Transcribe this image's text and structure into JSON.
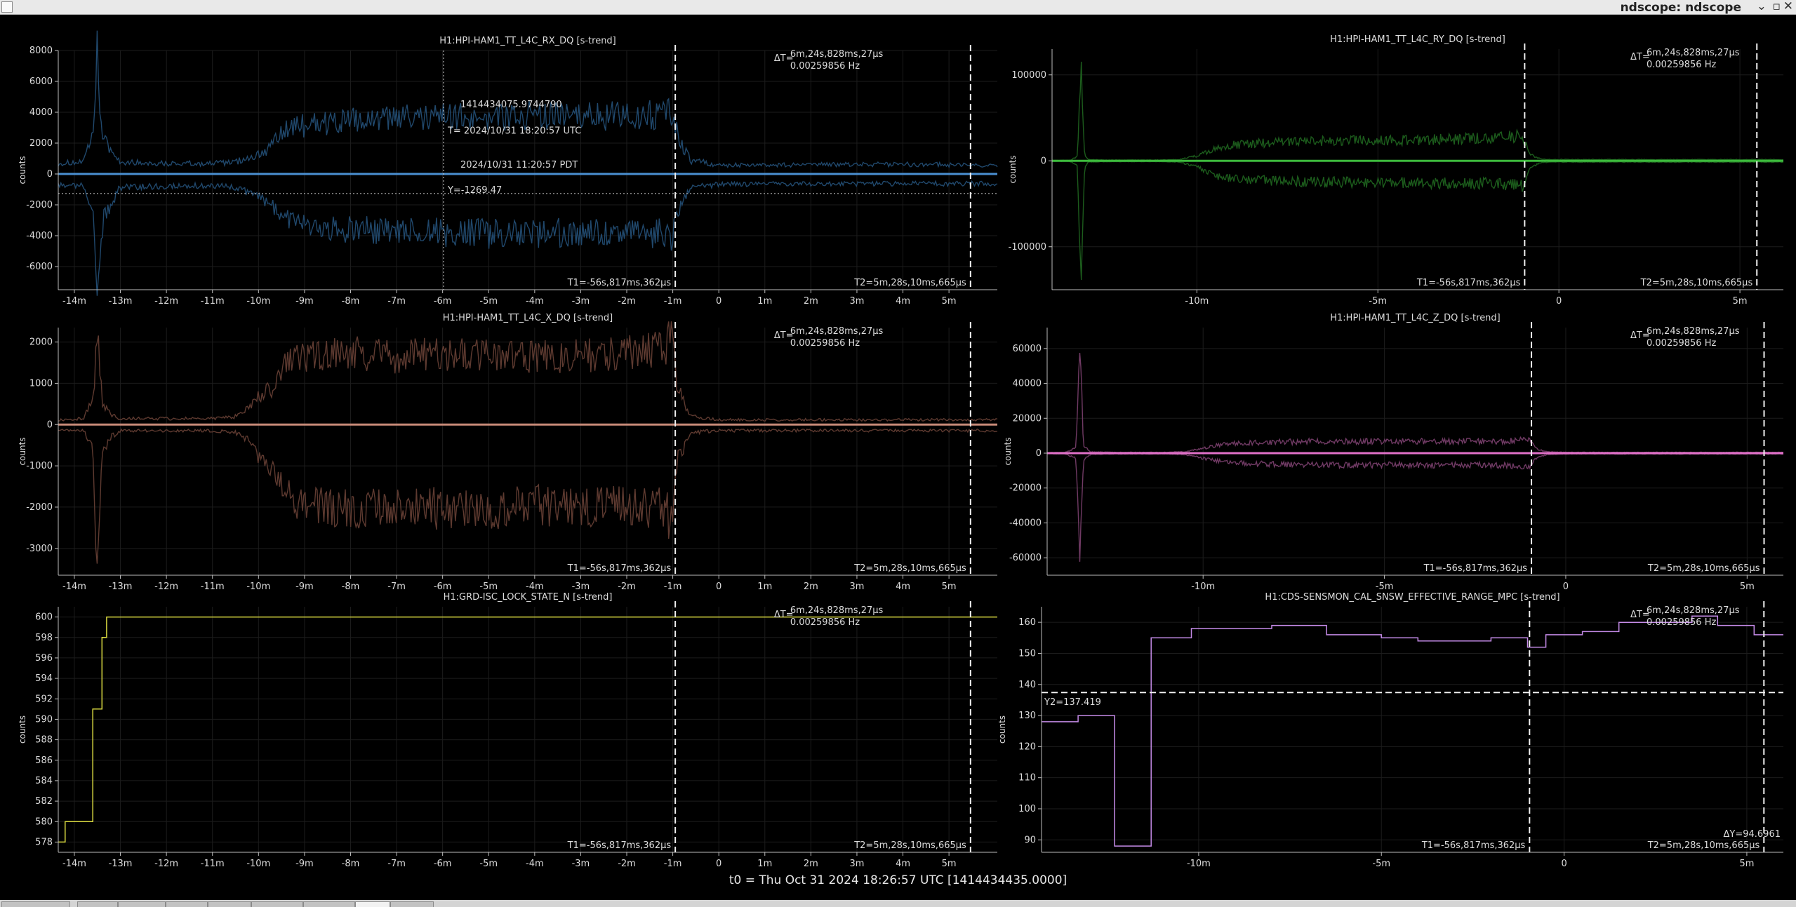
{
  "window": {
    "title": "ndscope: ndscope",
    "buttons": [
      "⌄",
      "▫",
      "✕"
    ]
  },
  "status": {
    "t0": "t0 = Thu Oct 31 2024 18:26:57 UTC [1414434435.0000]"
  },
  "chart_data": [
    {
      "type": "line",
      "title": "H1:HPI-HAM1_TT_L4C_RX_DQ [s-trend]",
      "ylabel": "counts",
      "xlabel": "",
      "color": "#4a8fd1",
      "band_color": "#20486c",
      "xlim": [
        -14.35,
        6.05
      ],
      "ylim": [
        -7500,
        8000
      ],
      "x_ticks": [
        -14,
        -13,
        -12,
        -11,
        -10,
        -9,
        -8,
        -7,
        -6,
        -5,
        -4,
        -3,
        -2,
        -1,
        0,
        1,
        2,
        3,
        4,
        5
      ],
      "x_tick_labels": [
        "-14m",
        "-13m",
        "-12m",
        "-11m",
        "-10m",
        "-9m",
        "-8m",
        "-7m",
        "-6m",
        "-5m",
        "-4m",
        "-3m",
        "-2m",
        "-1m",
        "0",
        "1m",
        "2m",
        "3m",
        "4m",
        "5m"
      ],
      "y_ticks": [
        -6000,
        -4000,
        -2000,
        0,
        2000,
        4000,
        6000,
        8000
      ],
      "y_tick_labels": [
        "-6000",
        "-4000",
        "-2000",
        "0",
        "2000",
        "4000",
        "6000",
        "8000"
      ],
      "envelope": {
        "x": [
          -14.35,
          -13.8,
          -13.6,
          -13.5,
          -13.4,
          -13.2,
          -13.0,
          -12.0,
          -11.0,
          -10.5,
          -10.3,
          -10.0,
          -9.7,
          -9.5,
          -9.3,
          -9.0,
          -8.0,
          -7.0,
          -6.0,
          -5.0,
          -4.0,
          -3.0,
          -2.0,
          -1.2,
          -1.0,
          -0.9,
          -0.6,
          0,
          1,
          2,
          3,
          4,
          5,
          6.05
        ],
        "upper": [
          700,
          800,
          2500,
          8000,
          2500,
          1500,
          800,
          700,
          700,
          800,
          1000,
          1300,
          1900,
          2600,
          3100,
          3300,
          3500,
          3700,
          3800,
          3900,
          3900,
          3800,
          3900,
          4000,
          4300,
          2500,
          900,
          600,
          600,
          600,
          650,
          650,
          600,
          550
        ],
        "lower": [
          -700,
          -800,
          -2500,
          -7500,
          -3500,
          -2000,
          -900,
          -800,
          -800,
          -900,
          -1100,
          -1500,
          -2100,
          -2700,
          -3200,
          -3500,
          -3700,
          -3800,
          -3900,
          -4000,
          -4000,
          -3900,
          -3900,
          -4000,
          -4200,
          -2500,
          -900,
          -700,
          -650,
          -650,
          -650,
          -650,
          -650,
          -650
        ]
      },
      "mean_y": 0,
      "cursor": {
        "x": -5.98,
        "y": -1269.47,
        "gps": "1414434075.9744790",
        "utc": "T= 2024/10/31 18:20:57 UTC",
        "local": "2024/10/31 11:20:57 PDT",
        "y_label": "Y=-1269.47"
      },
      "t1": -0.946,
      "t2": 5.468,
      "t1_label": "T1=-56s,817ms,362μs",
      "t2_label": "T2=5m,28s,10ms,665μs",
      "delta_label": "ΔT=",
      "delta_t": "6m,24s,828ms,27μs",
      "delta_hz": "0.00259856 Hz"
    },
    {
      "type": "line",
      "title": "H1:HPI-HAM1_TT_L4C_RY_DQ [s-trend]",
      "ylabel": "counts",
      "xlabel": "",
      "color": "#3dba3d",
      "band_color": "#1c5c1c",
      "xlim": [
        -14.0,
        6.2
      ],
      "ylim": [
        -150000,
        130000
      ],
      "x_ticks": [
        -10,
        -5,
        0,
        5
      ],
      "x_tick_labels": [
        "-10m",
        "-5m",
        "0",
        "5m"
      ],
      "y_ticks": [
        -100000,
        0,
        100000
      ],
      "y_tick_labels": [
        "-100000",
        "0",
        "100000"
      ],
      "envelope": {
        "x": [
          -14.0,
          -13.5,
          -13.3,
          -13.2,
          -13.1,
          -13.0,
          -12.5,
          -11.0,
          -10.5,
          -10.0,
          -9.5,
          -9.0,
          -8.0,
          -7.0,
          -6.0,
          -5.0,
          -4.0,
          -3.0,
          -2.0,
          -1.2,
          -1.0,
          -0.8,
          -0.5,
          0,
          2,
          4,
          6.2
        ],
        "upper": [
          600,
          800,
          5000,
          125000,
          8000,
          1500,
          1000,
          1000,
          1500,
          6000,
          14000,
          19000,
          22000,
          24000,
          24000,
          25000,
          25000,
          26000,
          27000,
          29000,
          30000,
          8000,
          2000,
          1500,
          1500,
          1500,
          1500
        ],
        "lower": [
          -600,
          -800,
          -5000,
          -135000,
          -8000,
          -1500,
          -1000,
          -1000,
          -1500,
          -7000,
          -18000,
          -21000,
          -24000,
          -25000,
          -26000,
          -26000,
          -26000,
          -27000,
          -27000,
          -29000,
          -30000,
          -8000,
          -2000,
          -1500,
          -1500,
          -1500,
          -1500
        ]
      },
      "mean_y": 0,
      "t1": -0.946,
      "t2": 5.468,
      "t1_label": "T1=-56s,817ms,362μs",
      "t2_label": "T2=5m,28s,10ms,665μs",
      "delta_label": "ΔT=",
      "delta_t": "6m,24s,828ms,27μs",
      "delta_hz": "0.00259856 Hz"
    },
    {
      "type": "line",
      "title": "H1:HPI-HAM1_TT_L4C_X_DQ [s-trend]",
      "ylabel": "counts",
      "xlabel": "",
      "color": "#c88a78",
      "band_color": "#5e3a30",
      "xlim": [
        -14.35,
        6.05
      ],
      "ylim": [
        -3650,
        2350
      ],
      "x_ticks": [
        -14,
        -13,
        -12,
        -11,
        -10,
        -9,
        -8,
        -7,
        -6,
        -5,
        -4,
        -3,
        -2,
        -1,
        0,
        1,
        2,
        3,
        4,
        5
      ],
      "x_tick_labels": [
        "-14m",
        "-13m",
        "-12m",
        "-11m",
        "-10m",
        "-9m",
        "-8m",
        "-7m",
        "-6m",
        "-5m",
        "-4m",
        "-3m",
        "-2m",
        "-1m",
        "0",
        "1m",
        "2m",
        "3m",
        "4m",
        "5m"
      ],
      "y_ticks": [
        -3000,
        -2000,
        -1000,
        0,
        1000,
        2000
      ],
      "y_tick_labels": [
        "-3000",
        "-2000",
        "-1000",
        "0",
        "1000",
        "2000"
      ],
      "envelope": {
        "x": [
          -14.35,
          -13.8,
          -13.6,
          -13.5,
          -13.4,
          -13.2,
          -13.0,
          -12.0,
          -11.0,
          -10.5,
          -10.2,
          -10.0,
          -9.7,
          -9.5,
          -9.3,
          -9.0,
          -8.0,
          -7.0,
          -6.0,
          -5.0,
          -4.0,
          -3.0,
          -2.0,
          -1.2,
          -1.0,
          -0.9,
          -0.6,
          0,
          1,
          2,
          3,
          4,
          5,
          6.05
        ],
        "upper": [
          120,
          150,
          600,
          2300,
          600,
          250,
          150,
          150,
          150,
          200,
          400,
          700,
          900,
          1300,
          1600,
          1700,
          1800,
          1700,
          1800,
          1700,
          1700,
          1700,
          1800,
          1900,
          2200,
          900,
          200,
          120,
          120,
          120,
          120,
          120,
          120,
          120
        ],
        "lower": [
          -120,
          -150,
          -600,
          -3650,
          -700,
          -300,
          -150,
          -150,
          -150,
          -200,
          -400,
          -800,
          -1100,
          -1500,
          -1800,
          -2000,
          -2100,
          -2000,
          -2100,
          -2100,
          -2000,
          -2100,
          -2000,
          -2100,
          -2500,
          -900,
          -200,
          -150,
          -150,
          -150,
          -150,
          -150,
          -150,
          -150
        ]
      },
      "mean_y": 0,
      "t1": -0.946,
      "t2": 5.468,
      "t1_label": "T1=-56s,817ms,362μs",
      "t2_label": "T2=5m,28s,10ms,665μs",
      "delta_label": "ΔT=",
      "delta_t": "6m,24s,828ms,27μs",
      "delta_hz": "0.00259856 Hz"
    },
    {
      "type": "line",
      "title": "H1:HPI-HAM1_TT_L4C_Z_DQ [s-trend]",
      "ylabel": "counts",
      "xlabel": "",
      "color": "#e070c8",
      "band_color": "#703a64",
      "xlim": [
        -14.3,
        6.0
      ],
      "ylim": [
        -70000,
        72000
      ],
      "x_ticks": [
        -10,
        -5,
        0,
        5
      ],
      "x_tick_labels": [
        "-10m",
        "-5m",
        "0",
        "5m"
      ],
      "y_ticks": [
        -60000,
        -40000,
        -20000,
        0,
        20000,
        40000,
        60000
      ],
      "y_tick_labels": [
        "-60000",
        "-40000",
        "-20000",
        "0",
        "20000",
        "40000",
        "60000"
      ],
      "envelope": {
        "x": [
          -14.3,
          -13.8,
          -13.5,
          -13.4,
          -13.3,
          -13.1,
          -12.5,
          -11.0,
          -10.5,
          -10.0,
          -9.5,
          -9.0,
          -8.0,
          -7.0,
          -6.0,
          -5.0,
          -4.0,
          -3.0,
          -2.0,
          -1.2,
          -1.0,
          -0.8,
          -0.5,
          0,
          2,
          4,
          6.0
        ],
        "upper": [
          300,
          500,
          3000,
          65000,
          4000,
          800,
          500,
          500,
          900,
          3000,
          5000,
          6000,
          6500,
          7000,
          7000,
          7000,
          7000,
          7000,
          7000,
          7500,
          8000,
          2500,
          800,
          500,
          500,
          500,
          500
        ],
        "lower": [
          -300,
          -500,
          -3000,
          -64000,
          -4000,
          -800,
          -500,
          -500,
          -900,
          -3000,
          -5000,
          -6000,
          -6500,
          -7000,
          -7000,
          -7000,
          -7000,
          -7000,
          -7000,
          -7500,
          -8000,
          -2500,
          -800,
          -500,
          -500,
          -500,
          -500
        ]
      },
      "mean_y": 0,
      "t1": -0.946,
      "t2": 5.468,
      "t1_label": "T1=-56s,817ms,362μs",
      "t2_label": "T2=5m,28s,10ms,665μs",
      "delta_label": "ΔT=",
      "delta_t": "6m,24s,828ms,27μs",
      "delta_hz": "0.00259856 Hz"
    },
    {
      "type": "line",
      "title": "H1:GRD-ISC_LOCK_STATE_N [s-trend]",
      "ylabel": "counts",
      "xlabel": "",
      "color": "#d8d840",
      "xlim": [
        -14.35,
        6.05
      ],
      "ylim": [
        577,
        601
      ],
      "x_ticks": [
        -14,
        -13,
        -12,
        -11,
        -10,
        -9,
        -8,
        -7,
        -6,
        -5,
        -4,
        -3,
        -2,
        -1,
        0,
        1,
        2,
        3,
        4,
        5
      ],
      "x_tick_labels": [
        "-14m",
        "-13m",
        "-12m",
        "-11m",
        "-10m",
        "-9m",
        "-8m",
        "-7m",
        "-6m",
        "-5m",
        "-4m",
        "-3m",
        "-2m",
        "-1m",
        "0",
        "1m",
        "2m",
        "3m",
        "4m",
        "5m"
      ],
      "y_ticks": [
        578,
        580,
        582,
        584,
        586,
        588,
        590,
        592,
        594,
        596,
        598,
        600
      ],
      "y_tick_labels": [
        "578",
        "580",
        "582",
        "584",
        "586",
        "588",
        "590",
        "592",
        "594",
        "596",
        "598",
        "600"
      ],
      "step": {
        "x": [
          -14.35,
          -14.2,
          -14.2,
          -13.6,
          -13.6,
          -13.4,
          -13.4,
          -13.3,
          -13.3,
          6.05
        ],
        "y": [
          578,
          578,
          580,
          580,
          591,
          591,
          598,
          598,
          600,
          600
        ]
      },
      "t1": -0.946,
      "t2": 5.468,
      "t1_label": "T1=-56s,817ms,362μs",
      "t2_label": "T2=5m,28s,10ms,665μs",
      "delta_label": "ΔT=",
      "delta_t": "6m,24s,828ms,27μs",
      "delta_hz": "0.00259856 Hz"
    },
    {
      "type": "line",
      "title": "H1:CDS-SENSMON_CAL_SNSW_EFFECTIVE_RANGE_MPC [s-trend]",
      "ylabel": "counts",
      "xlabel": "",
      "color": "#c58be8",
      "xlim": [
        -14.3,
        6.0
      ],
      "ylim": [
        86,
        165
      ],
      "x_ticks": [
        -10,
        -5,
        0,
        5
      ],
      "x_tick_labels": [
        "-10m",
        "-5m",
        "0",
        "5m"
      ],
      "y_ticks": [
        90,
        100,
        110,
        120,
        130,
        140,
        150,
        160
      ],
      "y_tick_labels": [
        "90",
        "100",
        "110",
        "120",
        "130",
        "140",
        "150",
        "160"
      ],
      "step": {
        "x": [
          -14.3,
          -13.3,
          -13.3,
          -12.3,
          -12.3,
          -11.3,
          -11.3,
          -10.2,
          -10.2,
          -8.0,
          -8.0,
          -6.5,
          -6.5,
          -5.0,
          -5.0,
          -4.0,
          -4.0,
          -2.0,
          -2.0,
          -1.0,
          -1.0,
          -0.5,
          -0.5,
          0.5,
          0.5,
          1.5,
          1.5,
          2.5,
          2.5,
          3.5,
          3.5,
          4.2,
          4.2,
          5.2,
          5.2,
          6.0
        ],
        "y": [
          128,
          128,
          130,
          130,
          88,
          88,
          155,
          155,
          158,
          158,
          159,
          159,
          156,
          156,
          155,
          155,
          154,
          154,
          155,
          155,
          152,
          152,
          156,
          156,
          157,
          157,
          160,
          160,
          160,
          160,
          162,
          162,
          159,
          159,
          156,
          156
        ]
      },
      "y2": 137.419,
      "y2_label": "Y2=137.419",
      "dy_label": "ΔY=94.6961",
      "t1": -0.946,
      "t2": 5.468,
      "t1_label": "T1=-56s,817ms,362μs",
      "t2_label": "T2=5m,28s,10ms,665μs",
      "delta_label": "ΔT=",
      "delta_t": "6m,24s,828ms,27μs",
      "delta_hz": "0.00259856 Hz"
    }
  ]
}
